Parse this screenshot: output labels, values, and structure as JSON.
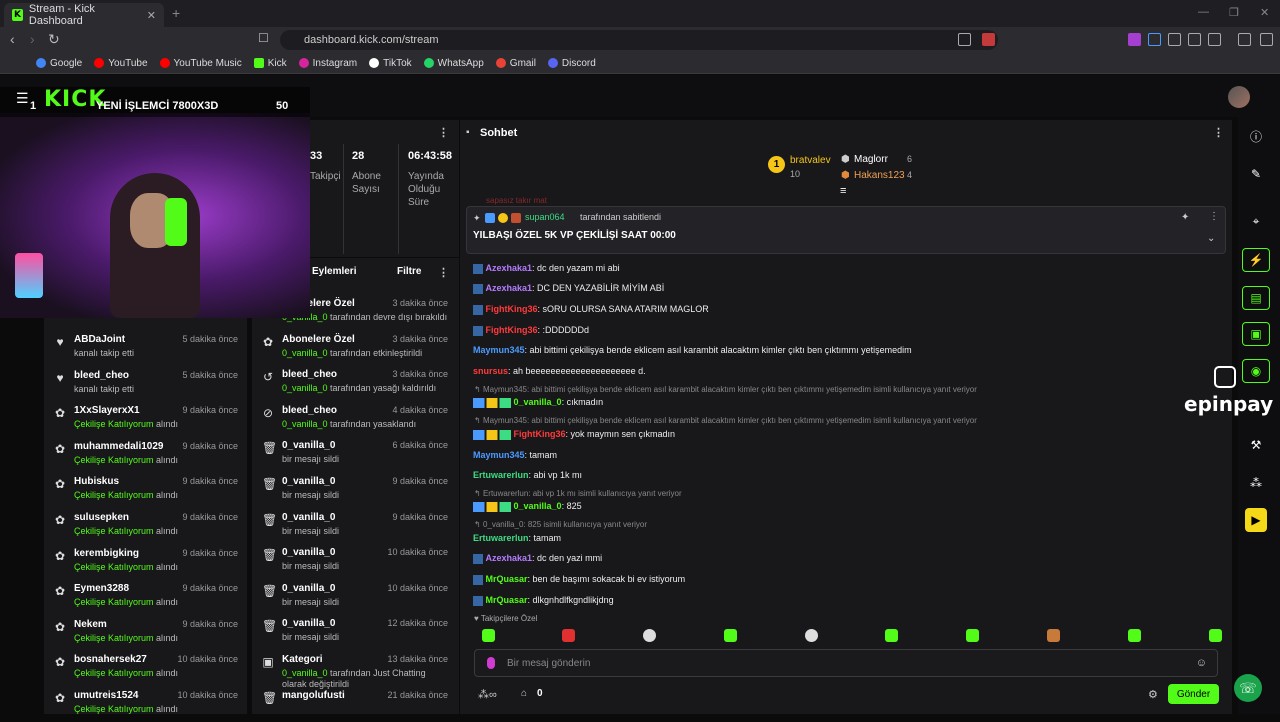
{
  "browser": {
    "tab_title": "Stream - Kick Dashboard",
    "url": "dashboard.kick.com/stream",
    "bookmarks": [
      "Google",
      "YouTube",
      "YouTube Music",
      "Kick",
      "Instagram",
      "TikTok",
      "WhatsApp",
      "Gmail",
      "Discord"
    ]
  },
  "overlay": {
    "logo": "KICK",
    "title": "YENİ İŞLEMCİ 7800X3D",
    "left_num": "1",
    "right_num": "50"
  },
  "stats": [
    {
      "value": "33",
      "label": "Takipçi"
    },
    {
      "value": "28",
      "label": "Abone Sayısı"
    },
    {
      "value": "06:43:58",
      "label": "Yayında Olduğu Süre"
    }
  ],
  "follows": [
    {
      "icon": "heart",
      "name": "ABDaJoint",
      "time": "5 dakika önce",
      "desc": "kanalı takip etti"
    },
    {
      "icon": "heart",
      "name": "bleed_cheo",
      "time": "5 dakika önce",
      "desc": "kanalı takip etti"
    },
    {
      "icon": "gift",
      "name": "1XxSlayerxX1",
      "time": "9 dakika önce",
      "desc_green": "Çekilişe Katılıyorum",
      "desc": " alındı"
    },
    {
      "icon": "gift",
      "name": "muhammedali1029",
      "time": "9 dakika önce",
      "desc_green": "Çekilişe Katılıyorum",
      "desc": " alındı"
    },
    {
      "icon": "gift",
      "name": "Hubiskus",
      "time": "9 dakika önce",
      "desc_green": "Çekilişe Katılıyorum",
      "desc": " alındı"
    },
    {
      "icon": "gift",
      "name": "sulusepken",
      "time": "9 dakika önce",
      "desc_green": "Çekilişe Katılıyorum",
      "desc": " alındı"
    },
    {
      "icon": "gift",
      "name": "kerembigking",
      "time": "9 dakika önce",
      "desc_green": "Çekilişe Katılıyorum",
      "desc": " alındı"
    },
    {
      "icon": "gift",
      "name": "Eymen3288",
      "time": "9 dakika önce",
      "desc_green": "Çekilişe Katılıyorum",
      "desc": " alındı"
    },
    {
      "icon": "gift",
      "name": "Nekem",
      "time": "9 dakika önce",
      "desc_green": "Çekilişe Katılıyorum",
      "desc": " alındı"
    },
    {
      "icon": "gift",
      "name": "bosnahersek27",
      "time": "10 dakika önce",
      "desc_green": "Çekilişe Katılıyorum",
      "desc": " alındı"
    },
    {
      "icon": "gift",
      "name": "umutreis1524",
      "time": "10 dakika önce",
      "desc_green": "Çekilişe Katılıyorum",
      "desc": " alındı"
    }
  ],
  "activity": {
    "title": "Eylemleri",
    "filter": "Filtre",
    "items": [
      {
        "icon": "sub",
        "name": "Abonelere Özel",
        "time": "3 dakika önce",
        "actor": "0_vanilla_0",
        "desc": " tarafından devre dışı bırakıldı"
      },
      {
        "icon": "gift",
        "name": "Abonelere Özel",
        "time": "3 dakika önce",
        "actor": "0_vanilla_0",
        "desc": " tarafından etkinleştirildi"
      },
      {
        "icon": "undo",
        "name": "bleed_cheo",
        "time": "3 dakika önce",
        "actor": "0_vanilla_0",
        "desc": " tarafından yasağı kaldırıldı"
      },
      {
        "icon": "ban",
        "name": "bleed_cheo",
        "time": "4 dakika önce",
        "actor": "0_vanilla_0",
        "desc": " tarafından yasaklandı"
      },
      {
        "icon": "trash",
        "name": "0_vanilla_0",
        "time": "6 dakika önce",
        "actor": "",
        "desc": "bir mesajı sildi"
      },
      {
        "icon": "trash",
        "name": "0_vanilla_0",
        "time": "9 dakika önce",
        "actor": "",
        "desc": "bir mesajı sildi"
      },
      {
        "icon": "trash",
        "name": "0_vanilla_0",
        "time": "9 dakika önce",
        "actor": "",
        "desc": "bir mesajı sildi"
      },
      {
        "icon": "trash",
        "name": "0_vanilla_0",
        "time": "10 dakika önce",
        "actor": "",
        "desc": "bir mesajı sildi"
      },
      {
        "icon": "trash",
        "name": "0_vanilla_0",
        "time": "10 dakika önce",
        "actor": "",
        "desc": "bir mesajı sildi"
      },
      {
        "icon": "trash",
        "name": "0_vanilla_0",
        "time": "12 dakika önce",
        "actor": "",
        "desc": "bir mesajı sildi"
      },
      {
        "icon": "category",
        "name": "Kategori",
        "time": "13 dakika önce",
        "actor": "0_vanilla_0",
        "desc": " tarafından Just Chatting olarak değiştirildi"
      },
      {
        "icon": "trash",
        "name": "mangolufusti",
        "time": "21 dakika önce",
        "actor": "",
        "desc": ""
      }
    ]
  },
  "chat": {
    "title": "Sohbet",
    "leaderboard": {
      "first_name": "bratvalev",
      "first_count": "10",
      "second_name": "Maglorr",
      "second_count": "6",
      "third_name": "Hakans123",
      "third_count": "4",
      "rank": "1"
    },
    "pinned": {
      "by": "supan064",
      "by_suffix": " tarafından sabitlendi",
      "text": "YILBAŞI ÖZEL 5K VP ÇEKİLİŞİ SAAT 00:00",
      "partial_above": "sapasız takır mat"
    },
    "messages": [
      {
        "user": "Azexhaka1",
        "color": "#b57cff",
        "text": ": dc den yazam mi abi"
      },
      {
        "user": "Azexhaka1",
        "color": "#b57cff",
        "text": ": DC DEN YAZABİLİR MİYİM ABİ"
      },
      {
        "user": "FightKing36",
        "color": "#ff3b3b",
        "text": ": sORU OLURSA SANA ATARIM MAGLOR"
      },
      {
        "user": "FightKing36",
        "color": "#ff3b3b",
        "text": ": :DDDDDDd"
      },
      {
        "user": "Maymun345",
        "color": "#4b9bff",
        "text": ": abi bittimi çekilişya bende eklicem asıl karambit alacaktım kimler çıktı ben çıktımmı yetişemedim"
      },
      {
        "user": "snursus",
        "color": "#ff3b3b",
        "text": ": ah beeeeeeeeeeeeeeeeeeeee d."
      },
      {
        "reply": "Maymun345: abi bittimi çekilişya bende eklicem asıl karambit alacaktım kimler çıktı ben çıktımmı yetişemedim isimli kullanıcıya yanıt veriyor"
      },
      {
        "user": "0_vanilla_0",
        "color": "#53fc18",
        "text": ": cıkmadın",
        "badges": true
      },
      {
        "reply": "Maymun345: abi bittimi çekilişya bende eklicem asıl karambit alacaktım kimler çıktı ben çıktımmı yetişemedim isimli kullanıcıya yanıt veriyor"
      },
      {
        "user": "FightKing36",
        "color": "#ff3b3b",
        "text": ": yok maymın sen çıkmadın",
        "badges": true
      },
      {
        "user": "Maymun345",
        "color": "#4b9bff",
        "text": ": tamam"
      },
      {
        "user": "Ertuwarerlun",
        "color": "#3ddc84",
        "text": ": abi vp 1k mı"
      },
      {
        "reply": "Ertuwarerlun: abi vp 1k mı isimli kullanıcıya yanıt veriyor"
      },
      {
        "user": "0_vanilla_0",
        "color": "#53fc18",
        "text": ": 825",
        "badges": true
      },
      {
        "reply": "0_vanilla_0: 825 isimli kullanıcıya yanıt veriyor"
      },
      {
        "user": "Ertuwarerlun",
        "color": "#3ddc84",
        "text": ": tamam"
      },
      {
        "user": "Azexhaka1",
        "color": "#b57cff",
        "text": ": dc den yazi mmi"
      },
      {
        "user": "MrQuasar",
        "color": "#53fc18",
        "text": ": ben de başımı sokacak bi ev istiyorum"
      },
      {
        "user": "MrQuasar",
        "color": "#53fc18",
        "text": ": dlkgnhdlfkgndlikjdng"
      }
    ],
    "followers_only": "Takipçilere Özel",
    "input_placeholder": "Bir mesaj gönderin",
    "points": "0",
    "send": "Gönder"
  },
  "sponsor": "epinpay",
  "colors": {
    "accent": "#53fc18",
    "bg": "#0b0b0c",
    "panel": "#18181b"
  }
}
